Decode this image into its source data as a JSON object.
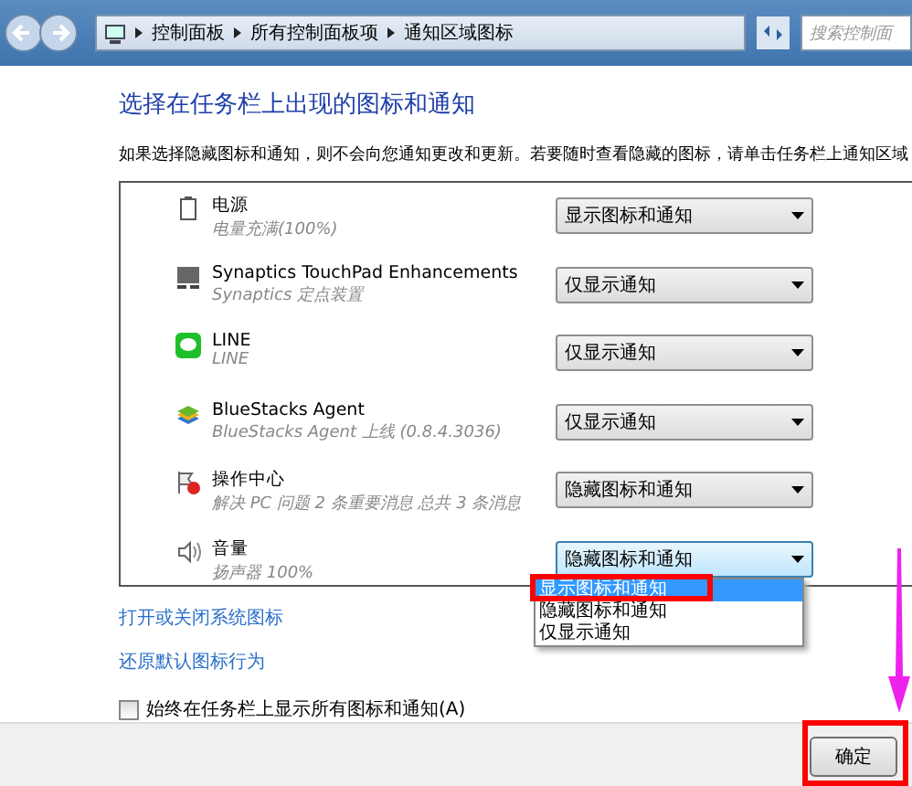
{
  "breadcrumb": [
    "控制面板",
    "所有控制面板项",
    "通知区域图标"
  ],
  "search": {
    "placeholder": "搜索控制面"
  },
  "heading": "选择在任务栏上出现的图标和通知",
  "description": "如果选择隐藏图标和通知，则不会向您通知更改和更新。若要随时查看隐藏的图标，请单击任务栏上通知区域",
  "rows": [
    {
      "kind": "power",
      "name": "电源",
      "detail": "电量充满(100%)",
      "setting": "显示图标和通知",
      "open": false
    },
    {
      "kind": "touchpad",
      "name": "Synaptics TouchPad Enhancements",
      "detail": "Synaptics 定点装置",
      "setting": "仅显示通知",
      "open": false
    },
    {
      "kind": "chat",
      "name": "LINE",
      "detail": "LINE",
      "setting": "仅显示通知",
      "open": false
    },
    {
      "kind": "stack",
      "name": "BlueStacks Agent",
      "detail": "BlueStacks Agent 上线 (0.8.4.3036)",
      "setting": "仅显示通知",
      "open": false
    },
    {
      "kind": "flag",
      "name": "操作中心",
      "detail": "解决 PC 问题  2 条重要消息  总共 3 条消息",
      "setting": "隐藏图标和通知",
      "open": false
    },
    {
      "kind": "speaker",
      "name": "音量",
      "detail": "扬声器 100%",
      "setting": "隐藏图标和通知",
      "open": true
    }
  ],
  "options": [
    {
      "label": "显示图标和通知",
      "selected": true,
      "highlighted": true
    },
    {
      "label": "隐藏图标和通知",
      "selected": false,
      "highlighted": false
    },
    {
      "label": "仅显示通知",
      "selected": false,
      "highlighted": false
    }
  ],
  "links": [
    "打开或关闭系统图标",
    "还原默认图标行为"
  ],
  "always_show": {
    "label": "始终在任务栏上显示所有图标和通知(A)",
    "checked": false
  },
  "ok_button": {
    "label": "确定",
    "highlighted": true
  }
}
